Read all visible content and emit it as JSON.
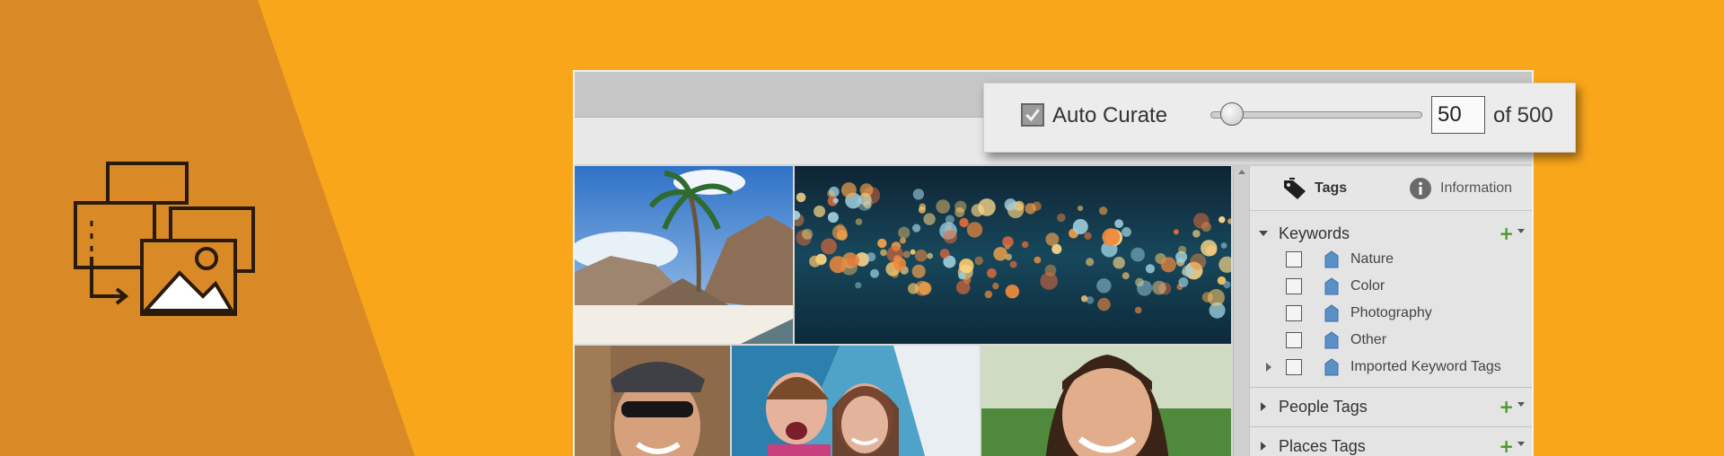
{
  "colors": {
    "background": "#f9a61b",
    "wedge": "#d98a27",
    "icon_stroke": "#2a1a0a",
    "add_green": "#4c9a2a",
    "tag_blue": "#5b8fc7"
  },
  "banner_icon": "organize-photos-icon",
  "curate_popup": {
    "checkbox_checked": true,
    "label": "Auto Curate",
    "slider_value": 50,
    "slider_max": 500,
    "count_value": "50",
    "of_label": "of 500"
  },
  "panel": {
    "tabs": [
      {
        "label": "Tags",
        "icon": "tag-icon",
        "active": true
      },
      {
        "label": "Information",
        "icon": "info-icon",
        "active": false
      }
    ],
    "keywords": {
      "label": "Keywords",
      "expanded": true,
      "add_symbol": "+",
      "items": [
        {
          "label": "Nature",
          "checked": false,
          "expandable": false
        },
        {
          "label": "Color",
          "checked": false,
          "expandable": false
        },
        {
          "label": "Photography",
          "checked": false,
          "expandable": false
        },
        {
          "label": "Other",
          "checked": false,
          "expandable": false
        },
        {
          "label": "Imported Keyword Tags",
          "checked": false,
          "expandable": true
        }
      ]
    },
    "people_tags": {
      "label": "People Tags",
      "expanded": false,
      "add_symbol": "+"
    },
    "places_tags": {
      "label": "Places Tags",
      "expanded": false,
      "add_symbol": "+"
    }
  },
  "photos": [
    "beach-rocks-palm",
    "city-lights-bokeh",
    "cyclist-helmet",
    "family-in-tent",
    "smiling-girl"
  ]
}
